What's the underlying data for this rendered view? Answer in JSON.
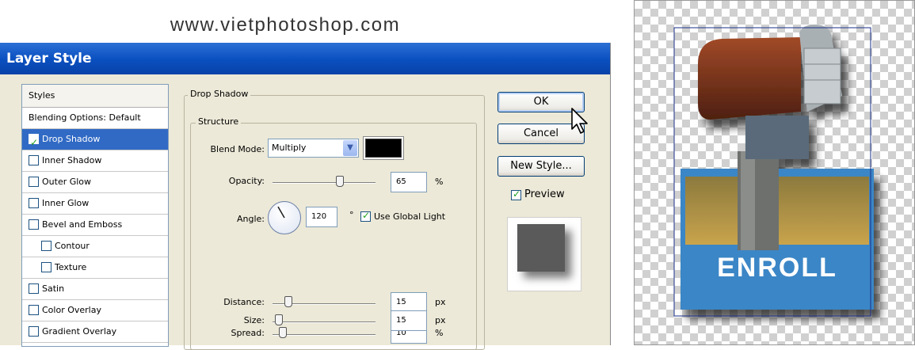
{
  "watermark": "www.vietphotoshop.com",
  "dialog": {
    "title": "Layer Style",
    "styles_header": "Styles",
    "style_items": [
      {
        "label": "Blending Options: Default",
        "checkbox": false,
        "checked": false,
        "selected": false,
        "indent": false
      },
      {
        "label": "Drop Shadow",
        "checkbox": true,
        "checked": true,
        "selected": true,
        "indent": false
      },
      {
        "label": "Inner Shadow",
        "checkbox": true,
        "checked": false,
        "selected": false,
        "indent": false
      },
      {
        "label": "Outer Glow",
        "checkbox": true,
        "checked": false,
        "selected": false,
        "indent": false
      },
      {
        "label": "Inner Glow",
        "checkbox": true,
        "checked": false,
        "selected": false,
        "indent": false
      },
      {
        "label": "Bevel and Emboss",
        "checkbox": true,
        "checked": false,
        "selected": false,
        "indent": false
      },
      {
        "label": "Contour",
        "checkbox": true,
        "checked": false,
        "selected": false,
        "indent": true
      },
      {
        "label": "Texture",
        "checkbox": true,
        "checked": false,
        "selected": false,
        "indent": true
      },
      {
        "label": "Satin",
        "checkbox": true,
        "checked": false,
        "selected": false,
        "indent": false
      },
      {
        "label": "Color Overlay",
        "checkbox": true,
        "checked": false,
        "selected": false,
        "indent": false
      },
      {
        "label": "Gradient Overlay",
        "checkbox": true,
        "checked": false,
        "selected": false,
        "indent": false
      }
    ],
    "section_title": "Drop Shadow",
    "structure_title": "Structure",
    "blend_mode_label": "Blend Mode:",
    "blend_mode_value": "Multiply",
    "shadow_color": "#000000",
    "opacity_label": "Opacity:",
    "opacity_value": "65",
    "opacity_unit": "%",
    "opacity_fraction": 0.65,
    "angle_label": "Angle:",
    "angle_value": "120",
    "angle_unit": "°",
    "angle_degrees": 120,
    "use_global_light_label": "Use Global Light",
    "use_global_light_checked": true,
    "distance_label": "Distance:",
    "distance_value": "15",
    "distance_unit": "px",
    "distance_fraction": 0.15,
    "spread_label": "Spread:",
    "spread_value": "10",
    "spread_unit": "%",
    "spread_fraction": 0.1,
    "size_label": "Size:",
    "size_value": "15",
    "size_unit": "px",
    "size_fraction": 0.06,
    "ok_label": "OK",
    "cancel_label": "Cancel",
    "new_style_label": "New Style...",
    "preview_label": "Preview",
    "preview_checked": true
  },
  "artwork": {
    "banner_text": "ENROLL",
    "banner_color": "#3b86c6"
  }
}
